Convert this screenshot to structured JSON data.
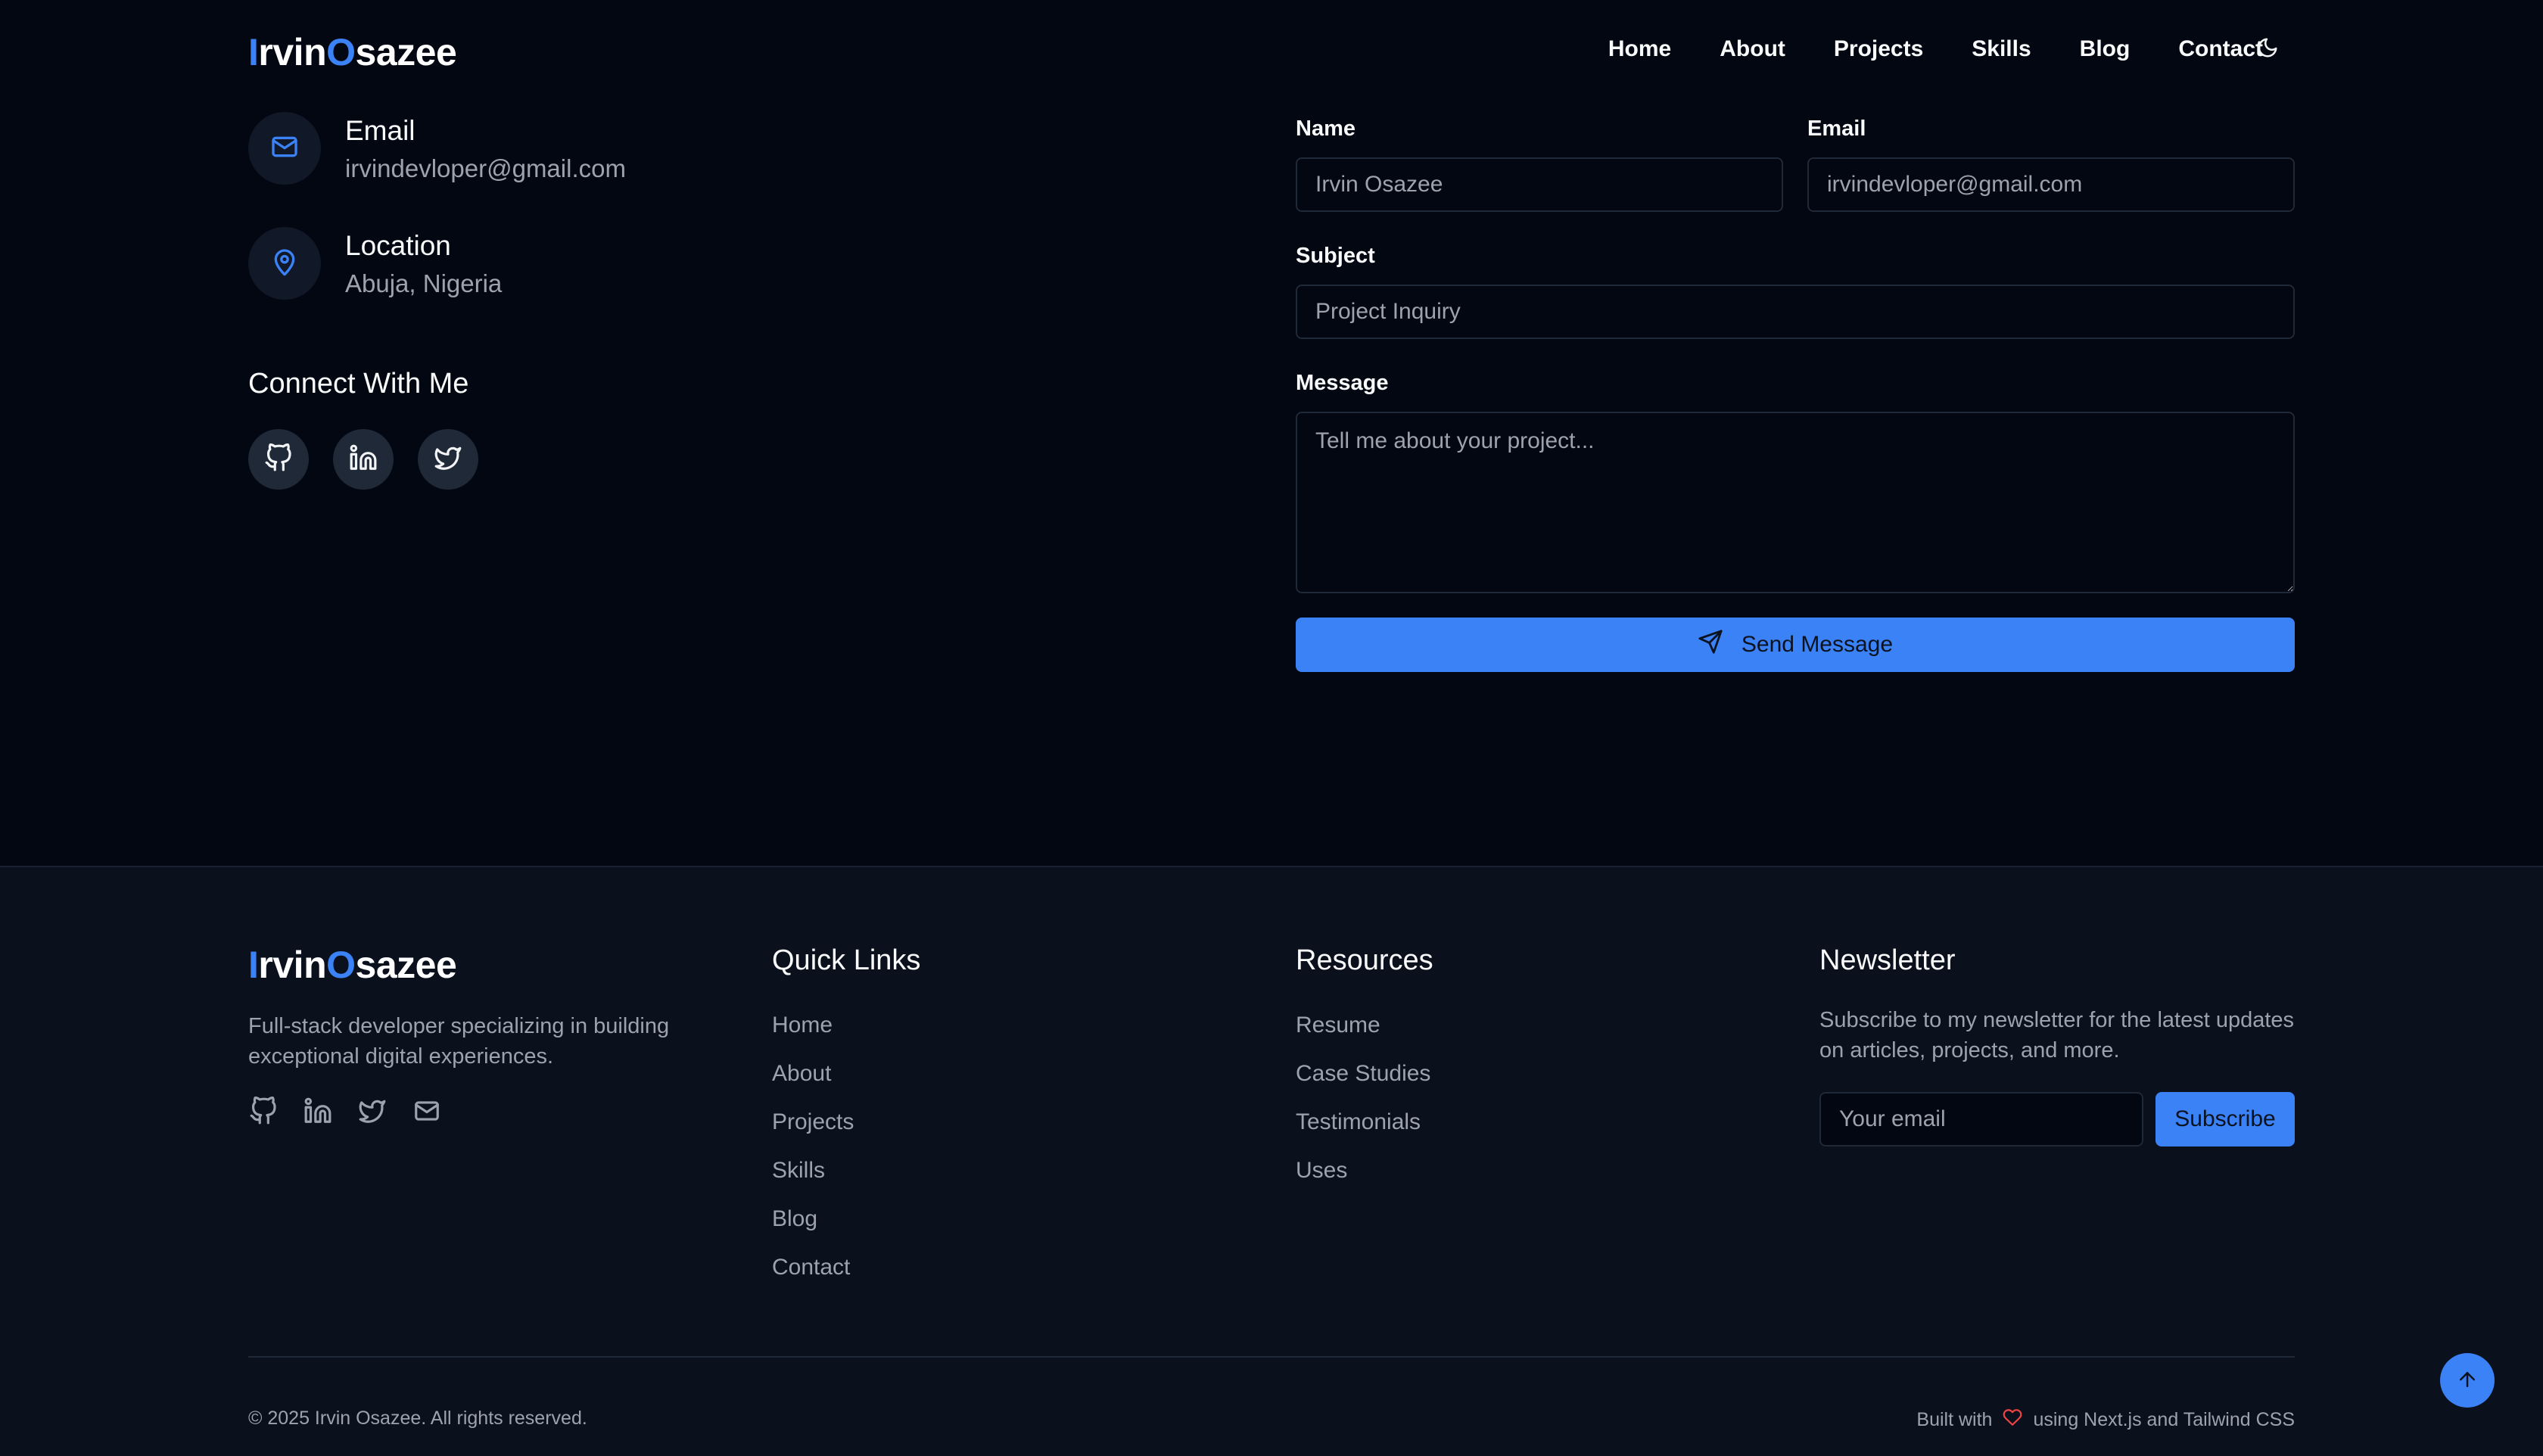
{
  "brand": {
    "first_initial": "I",
    "first_rest": "rvin",
    "last_initial": "O",
    "last_rest": "sazee"
  },
  "nav": {
    "items": [
      {
        "label": "Home"
      },
      {
        "label": "About"
      },
      {
        "label": "Projects"
      },
      {
        "label": "Skills"
      },
      {
        "label": "Blog"
      },
      {
        "label": "Contact"
      }
    ],
    "theme_icon": "moon-icon"
  },
  "contact_info": {
    "email": {
      "title": "Email",
      "value": "irvindevloper@gmail.com",
      "icon": "mail-icon"
    },
    "location": {
      "title": "Location",
      "value": "Abuja, Nigeria",
      "icon": "map-pin-icon"
    }
  },
  "connect": {
    "title": "Connect With Me",
    "icons": [
      "github-icon",
      "linkedin-icon",
      "twitter-icon"
    ]
  },
  "form": {
    "name_label": "Name",
    "name_placeholder": "Irvin Osazee",
    "email_label": "Email",
    "email_placeholder": "irvindevloper@gmail.com",
    "subject_label": "Subject",
    "subject_placeholder": "Project Inquiry",
    "message_label": "Message",
    "message_placeholder": "Tell me about your project...",
    "submit_label": "Send Message"
  },
  "footer": {
    "description": "Full-stack developer specializing in building exceptional digital experiences.",
    "icons": [
      "github-icon",
      "linkedin-icon",
      "twitter-icon",
      "mail-icon"
    ],
    "quick_links": {
      "title": "Quick Links",
      "items": [
        "Home",
        "About",
        "Projects",
        "Skills",
        "Blog",
        "Contact"
      ]
    },
    "resources": {
      "title": "Resources",
      "items": [
        "Resume",
        "Case Studies",
        "Testimonials",
        "Uses"
      ]
    },
    "newsletter": {
      "title": "Newsletter",
      "text": "Subscribe to my newsletter for the latest updates on articles, projects, and more.",
      "placeholder": "Your email",
      "button_label": "Subscribe"
    },
    "copyright": "© 2025 Irvin Osazee. All rights reserved.",
    "built_with_prefix": "Built with",
    "built_with_suffix": "using Next.js and Tailwind CSS"
  },
  "colors": {
    "accent": "#3b82f6",
    "background": "#030712",
    "footer_bg": "#0b101d",
    "heart": "#ef4444"
  }
}
